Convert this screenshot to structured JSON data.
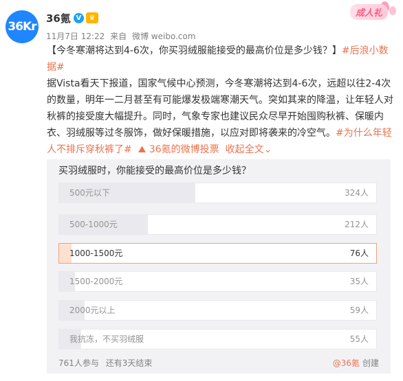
{
  "author": {
    "avatar_text": "36Kr",
    "name": "36氪",
    "verified_glyph": "V",
    "badge_glyph": "♛"
  },
  "meta": {
    "date": "11月7日 12:22",
    "from": "来自",
    "source": "微博 weibo.com"
  },
  "promo": {
    "label": "成人礼"
  },
  "post": {
    "line1_prefix": "【今冬寒潮将达到4-6次，你买羽绒服能接受的最高价位是多少钱？】",
    "topic1": "#后浪小数据#",
    "body": "据Vista看天下报道，国家气候中心预测，今冬寒潮将达到4-6次，远超以往2-4次的数量，明年一二月甚至有可能爆发极端寒潮天气。突如其来的降温，让年轻人对秋裤的接受度大幅提升。同时，气象专家也建议民众尽早开始囤购秋裤、保暖内衣、羽绒服等过冬服饰，做好保暖措施，以应对即将袭来的冷空气。",
    "topic2": "#为什么年轻人不排斥穿秋裤了#",
    "vote_link": "36氪的微博投票",
    "expand": "收起全文"
  },
  "poll": {
    "question": "买羽绒服时，你能接受的最高价位是多少钱？",
    "options": [
      {
        "label": "500元以下",
        "count": "324人",
        "share": 0.43
      },
      {
        "label": "500-1000元",
        "count": "212人",
        "share": 0.28
      },
      {
        "label": "1000-1500元",
        "count": "76人",
        "share": 0.04,
        "selected": true
      },
      {
        "label": "1500-2000元",
        "count": "35人",
        "share": 0.05
      },
      {
        "label": "2000元以上",
        "count": "59人",
        "share": 0.08
      },
      {
        "label": "我抗冻，不买羽绒服",
        "count": "55人",
        "share": 0.07
      }
    ],
    "participants": "761人参与",
    "remaining": "还有3天结束",
    "creator": "@36氪",
    "created": "创建"
  },
  "colors": {
    "accent": "#eb7350",
    "avatar_bg": "#1f86ff",
    "poll_bg": "#f2f2f5"
  }
}
